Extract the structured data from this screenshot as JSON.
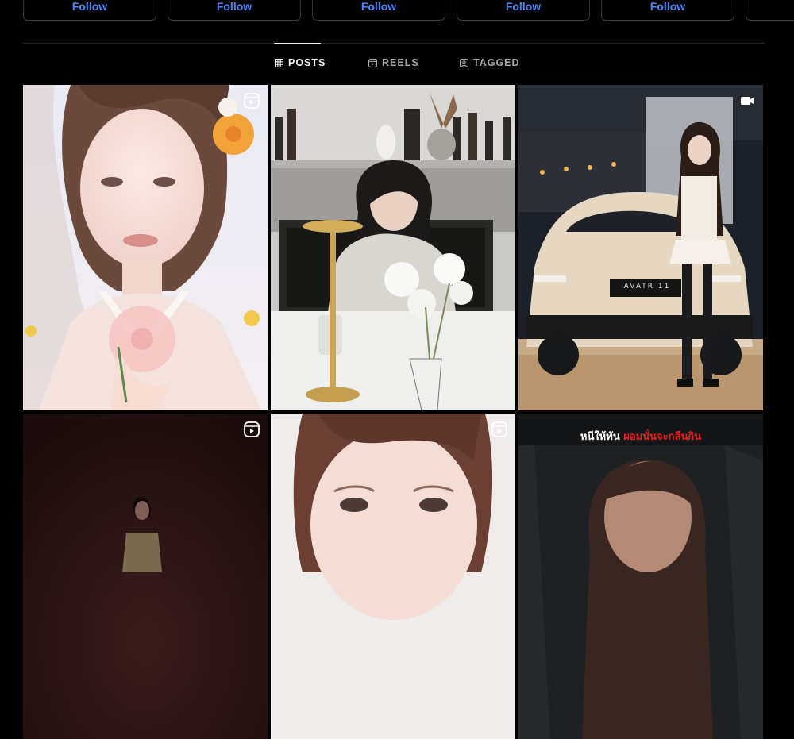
{
  "follow_buttons": [
    {
      "label": "Follow"
    },
    {
      "label": "Follow"
    },
    {
      "label": "Follow"
    },
    {
      "label": "Follow"
    },
    {
      "label": "Follow"
    },
    {
      "label": ""
    }
  ],
  "tabs": [
    {
      "label": "POSTS",
      "icon": "grid-icon",
      "active": true
    },
    {
      "label": "REELS",
      "icon": "reels-icon",
      "active": false
    },
    {
      "label": "TAGGED",
      "icon": "tagged-icon",
      "active": false
    }
  ],
  "posts": [
    {
      "type": "reel",
      "badge_icon": "reel-badge-icon"
    },
    {
      "type": "photo",
      "badge_icon": ""
    },
    {
      "type": "video",
      "badge_icon": "video-badge-icon",
      "car_plate": "AVATR 11"
    },
    {
      "type": "reel",
      "badge_icon": "reel-badge-icon"
    },
    {
      "type": "reel",
      "badge_icon": "reel-badge-icon"
    },
    {
      "type": "photo",
      "caption_white": "หนีให้ทัน",
      "caption_red": "ผอมนั่นจะกลืนกิน"
    }
  ],
  "colors": {
    "background": "#000000",
    "link_blue": "#4a86f5",
    "divider": "#262626",
    "tab_inactive": "#a8a8a8",
    "tab_active": "#f5f5f5"
  }
}
